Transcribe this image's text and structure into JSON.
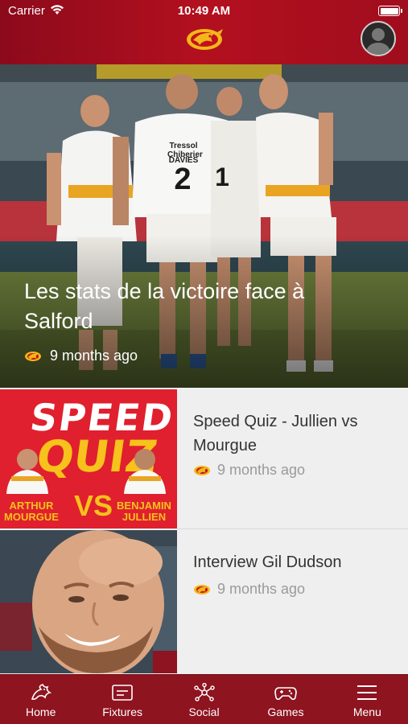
{
  "status_bar": {
    "carrier": "Carrier",
    "time": "10:49 AM"
  },
  "header": {
    "logo_icon": "dragon-logo-icon",
    "avatar_icon": "user-avatar-icon"
  },
  "featured": {
    "title": "Les stats de la victoire face à Salford",
    "time_ago": "9 months ago",
    "jerseys": {
      "player_2_name": "DAVIES",
      "player_2_number": "2",
      "player_1_number": "1",
      "sponsor": "Tressol Chiberier"
    }
  },
  "articles": [
    {
      "title": "Speed Quiz - Jullien vs Mourgue",
      "time_ago": "9 months ago",
      "thumb": {
        "line1": "SPEED",
        "line2": "QUIZ",
        "vs": "VS",
        "left_first": "ARTHUR",
        "left_last": "MOURGUE",
        "right_first": "BENJAMIN",
        "right_last": "JULLIEN"
      }
    },
    {
      "title": "Interview Gil Dudson",
      "time_ago": "9 months ago"
    }
  ],
  "tabs": [
    {
      "label": "Home",
      "icon": "dragon-icon"
    },
    {
      "label": "Fixtures",
      "icon": "calendar-card-icon"
    },
    {
      "label": "Social",
      "icon": "network-icon"
    },
    {
      "label": "Games",
      "icon": "gamepad-icon"
    },
    {
      "label": "Menu",
      "icon": "hamburger-icon"
    }
  ],
  "colors": {
    "brand_red": "#a00d1d",
    "tab_bar": "#8e1420",
    "accent_gold": "#f2b71a",
    "speed_quiz_red": "#e0202e"
  }
}
